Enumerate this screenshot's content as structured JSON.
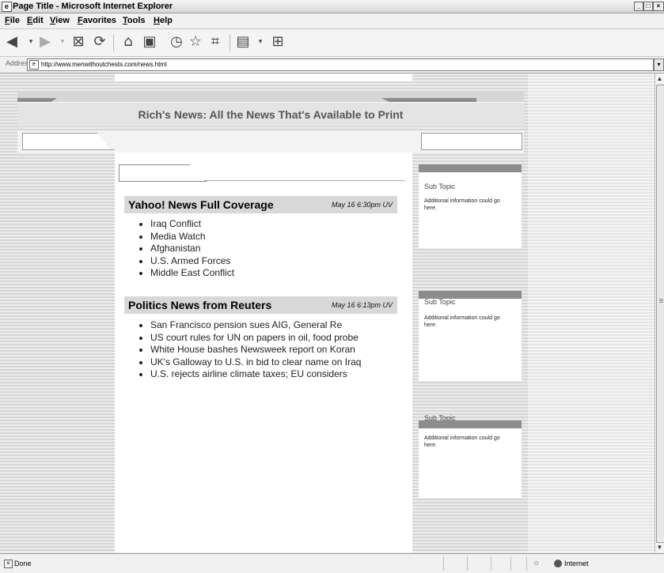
{
  "window": {
    "title": "Page Title - Microsoft Internet Explorer",
    "controls": [
      "minimize",
      "maximize",
      "close"
    ]
  },
  "menu": {
    "items": [
      "File",
      "Edit",
      "View",
      "Favorites",
      "Tools",
      "Help"
    ]
  },
  "toolbar": {
    "icons": [
      "back-icon",
      "forward-icon",
      "stop-icon",
      "refresh-icon",
      "home-icon",
      "page-icon",
      "history-icon",
      "favorites-icon",
      "media-icon",
      "print-icon",
      "network-icon"
    ]
  },
  "address": {
    "label": "Address",
    "url": "http://www.menwithoutchests.com/news.html"
  },
  "page": {
    "site_title": "Rich's News: All the News That's Available to Print",
    "sections": [
      {
        "heading": "Yahoo! News Full Coverage",
        "timestamp": "May 16 6:30pm UV",
        "items": [
          "Iraq Conflict",
          "Media Watch",
          "Afghanistan",
          "U.S. Armed Forces",
          "Middle East Conflict"
        ]
      },
      {
        "heading": "Politics News from Reuters",
        "timestamp": "May 16 6:13pm UV",
        "items": [
          "San Francisco pension sues AIG, General Re",
          "US court rules for UN on papers in oil, food probe",
          "White House bashes Newsweek report on Koran",
          "UK's Galloway to U.S. in bid to clear name on Iraq",
          "U.S. rejects airline climate taxes; EU considers"
        ]
      }
    ],
    "sidebar": [
      {
        "title": "Sub Topic",
        "text": "Additional information could go here."
      },
      {
        "title": "Sub Topic",
        "text": "Additional information could go here."
      },
      {
        "title": "Sub Topic",
        "text": "Additional information could go here."
      }
    ]
  },
  "status": {
    "left": "Done",
    "zone": "Internet"
  }
}
